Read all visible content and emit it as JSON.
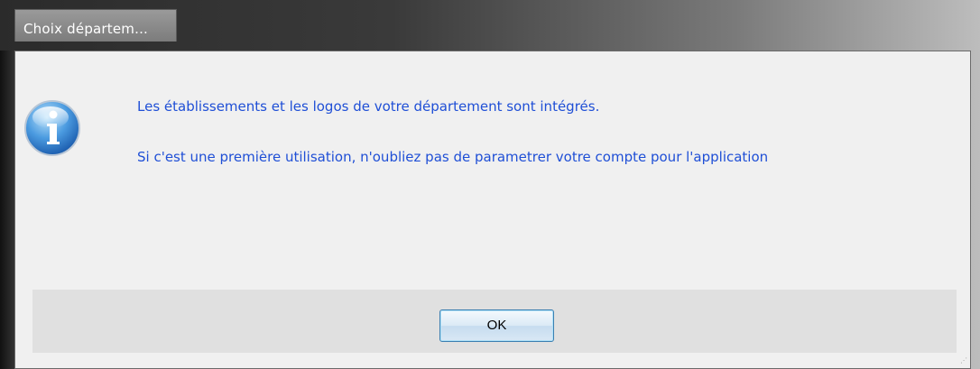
{
  "window": {
    "title": "Choix départem..."
  },
  "dialog": {
    "icon": "info-icon",
    "message_line_1": "Les établissements et les logos de votre département sont intégrés.",
    "message_line_2": "Si c'est une première utilisation, n'oubliez pas de parametrer votre compte pour l'application"
  },
  "buttons": {
    "ok_label": "OK"
  },
  "colors": {
    "message_text": "#1f4fd6",
    "client_background": "#f0f0f0",
    "button_bar": "#e0e0e0",
    "ok_border": "#3c7fb1"
  }
}
